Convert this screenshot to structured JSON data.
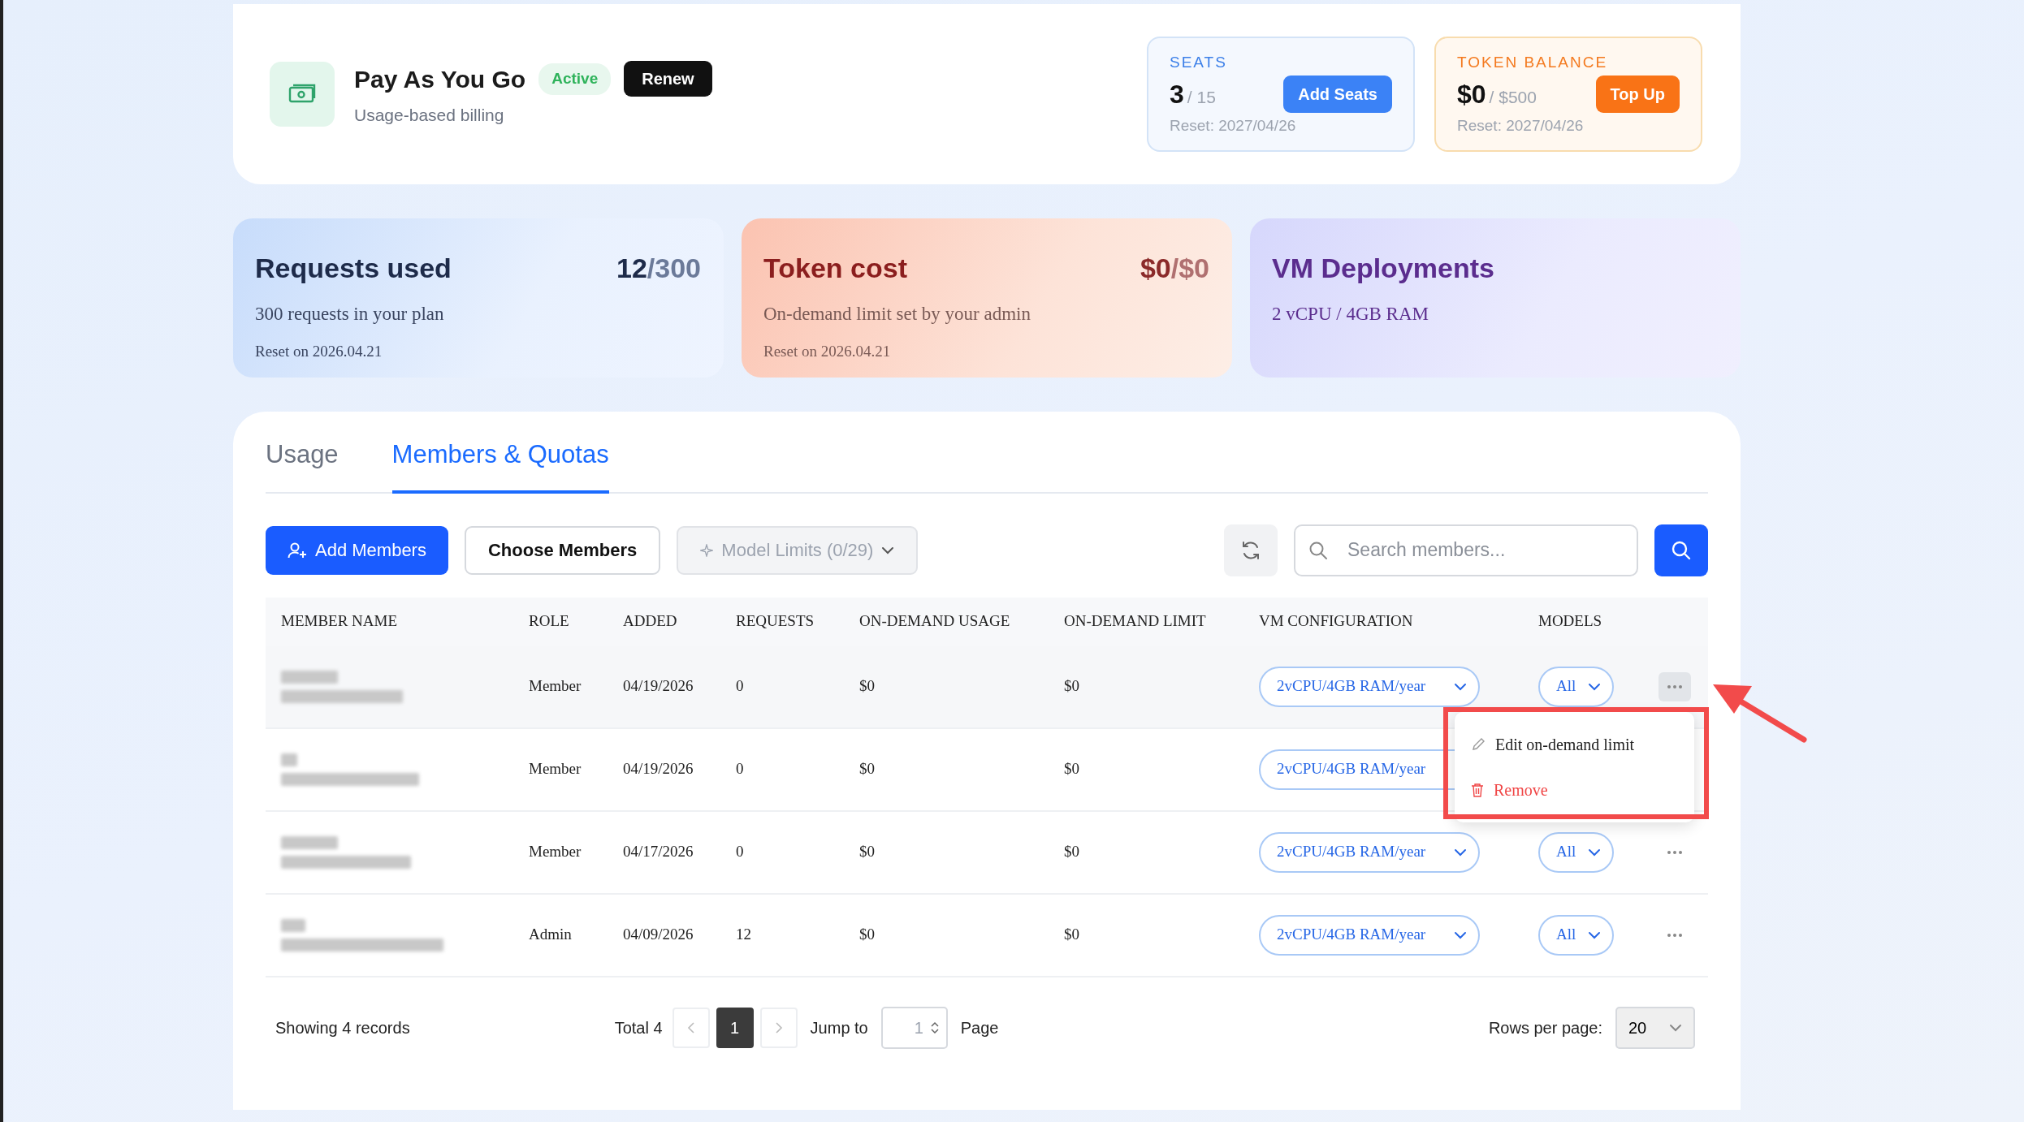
{
  "plan": {
    "title": "Pay As You Go",
    "status": "Active",
    "renew": "Renew",
    "subtitle": "Usage-based billing"
  },
  "balances": [
    {
      "kind": "seats",
      "label": "SEATS",
      "value": "3",
      "total": "/ 15",
      "button": "Add Seats",
      "reset": "Reset: 2027/04/26"
    },
    {
      "kind": "tokens",
      "label": "TOKEN BALANCE",
      "value": "$0",
      "total": "/ $500",
      "button": "Top Up",
      "reset": "Reset: 2027/04/26"
    }
  ],
  "stat_cards": [
    {
      "kind": "requests",
      "title": "Requests used",
      "used": "12",
      "limit": "/300",
      "description": "300 requests in your plan",
      "reset": "Reset on 2026.04.21"
    },
    {
      "kind": "token",
      "title": "Token cost",
      "used": "$0",
      "limit": "/$0",
      "description": "On-demand limit set by your admin",
      "reset": "Reset on 2026.04.21"
    },
    {
      "kind": "vm",
      "title": "VM Deployments",
      "description": "2 vCPU / 4GB RAM"
    }
  ],
  "tabs": [
    {
      "label": "Usage",
      "selected": false
    },
    {
      "label": "Members & Quotas",
      "selected": true
    }
  ],
  "toolbar": {
    "add_button": "Add Members",
    "choose_button": "Choose Members",
    "model_limits": {
      "label": "Model Limits (0/29)",
      "disabled": true
    },
    "search": {
      "placeholder": "Search members..."
    }
  },
  "table": {
    "columns": [
      "MEMBER NAME",
      "ROLE",
      "ADDED",
      "REQUESTS",
      "ON-DEMAND USAGE",
      "ON-DEMAND LIMIT",
      "VM CONFIGURATION",
      "MODELS"
    ],
    "rows": [
      {
        "role": "Member",
        "added": "04/19/2026",
        "requests": "0",
        "usage": "$0",
        "limit": "$0",
        "vm": "2vCPU/4GB RAM/year",
        "models": "All",
        "more": true,
        "active": true
      },
      {
        "role": "Member",
        "added": "04/19/2026",
        "requests": "0",
        "usage": "$0",
        "limit": "$0",
        "vm": "2vCPU/4GB RAM/year"
      },
      {
        "role": "Member",
        "added": "04/17/2026",
        "requests": "0",
        "usage": "$0",
        "limit": "$0",
        "vm": "2vCPU/4GB RAM/year",
        "models": "All",
        "more": true,
        "active": false
      },
      {
        "role": "Admin",
        "added": "04/09/2026",
        "requests": "12",
        "usage": "$0",
        "limit": "$0",
        "vm": "2vCPU/4GB RAM/year",
        "models": "All",
        "more": true,
        "active": false
      }
    ]
  },
  "row_menu": {
    "items": [
      {
        "kind": "edit",
        "label": "Edit on-demand limit"
      },
      {
        "kind": "remove",
        "label": "Remove"
      }
    ]
  },
  "annotation": {
    "highlight_box": true,
    "arrow": true
  },
  "pagination": {
    "summary": "Showing 4 records",
    "total": "Total 4",
    "pages": [
      {
        "label": "1",
        "selected": true
      }
    ],
    "jump_label": "Jump to",
    "jump_value": "1",
    "page_label": "Page",
    "rows_label": "Rows per page:",
    "rows_value": "20"
  }
}
